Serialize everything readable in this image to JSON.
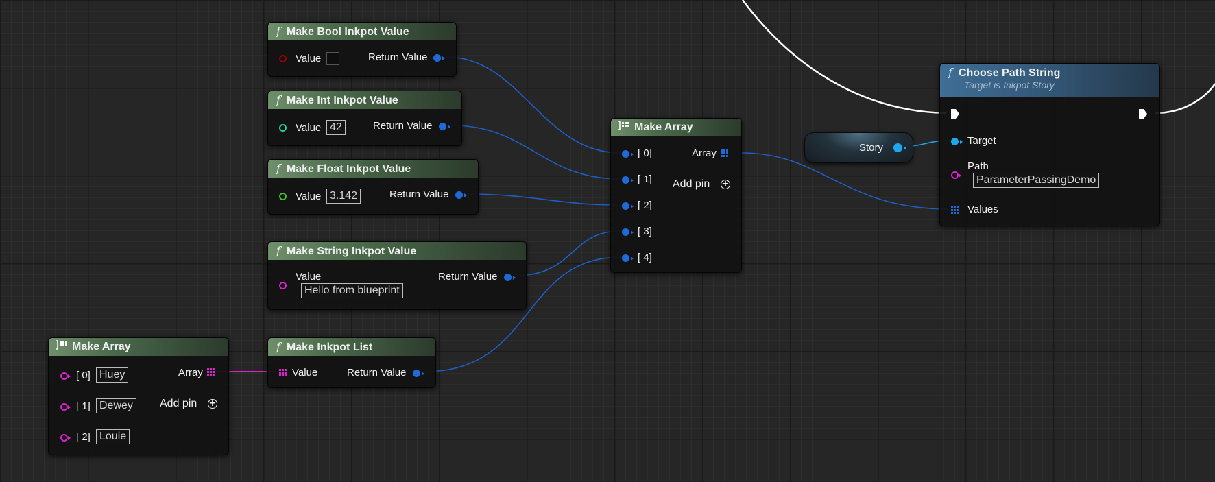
{
  "colors": {
    "background": "#262626",
    "object_pin": "#1d6ad8",
    "bool_pin": "#9b0000",
    "int_pin": "#1fd2a0",
    "float_pin": "#3ec02f",
    "string_pin": "#e020d0",
    "target_pin": "#1ea6ee",
    "exec_wire": "#ffffff"
  },
  "nodes": {
    "make_bool": {
      "title": "Make Bool Inkpot Value",
      "icon": "function-icon",
      "value_label": "Value",
      "return_label": "Return Value"
    },
    "make_int": {
      "title": "Make Int Inkpot Value",
      "icon": "function-icon",
      "value_label": "Value",
      "value": "42",
      "return_label": "Return Value"
    },
    "make_float": {
      "title": "Make Float Inkpot Value",
      "icon": "function-icon",
      "value_label": "Value",
      "value": "3.142",
      "return_label": "Return Value"
    },
    "make_string": {
      "title": "Make String Inkpot Value",
      "icon": "function-icon",
      "value_label": "Value",
      "value": "Hello from blueprint",
      "return_label": "Return Value"
    },
    "make_list": {
      "title": "Make Inkpot List",
      "icon": "function-icon",
      "value_label": "Value",
      "return_label": "Return Value"
    },
    "make_array_left": {
      "title": "Make Array",
      "icon": "make-array-icon",
      "items": [
        {
          "index": "[ 0]",
          "value": "Huey"
        },
        {
          "index": "[ 1]",
          "value": "Dewey"
        },
        {
          "index": "[ 2]",
          "value": "Louie"
        }
      ],
      "output_label": "Array",
      "add_pin_label": "Add pin"
    },
    "make_array_center": {
      "title": "Make Array",
      "icon": "make-array-icon",
      "items": [
        "[ 0]",
        "[ 1]",
        "[ 2]",
        "[ 3]",
        "[ 4]"
      ],
      "output_label": "Array",
      "add_pin_label": "Add pin"
    },
    "choose_path": {
      "title": "Choose Path String",
      "subtitle": "Target is Inkpot Story",
      "icon": "function-icon",
      "target_label": "Target",
      "path_label": "Path",
      "path_value": "ParameterPassingDemo",
      "values_label": "Values"
    },
    "story_var": {
      "label": "Story"
    }
  }
}
